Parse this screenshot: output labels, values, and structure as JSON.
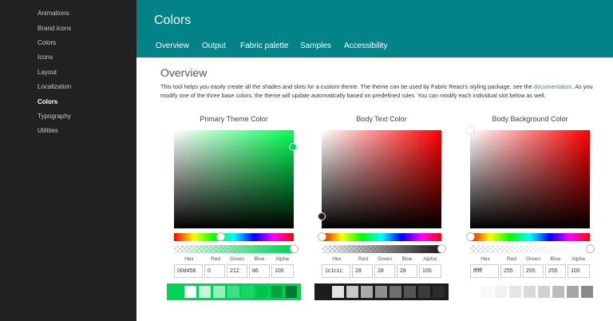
{
  "sidebar": {
    "items": [
      {
        "label": "Animations"
      },
      {
        "label": "Brand icons"
      },
      {
        "label": "Colors"
      },
      {
        "label": "Icons"
      },
      {
        "label": "Layout"
      },
      {
        "label": "Localization"
      },
      {
        "label": "Colors",
        "active": true
      },
      {
        "label": "Typography"
      },
      {
        "label": "Utilities"
      }
    ]
  },
  "header": {
    "title": "Colors",
    "tabs": [
      {
        "label": "Overview"
      },
      {
        "label": "Output"
      },
      {
        "label": "Fabric palette"
      },
      {
        "label": "Samples"
      },
      {
        "label": "Accessibility"
      }
    ]
  },
  "overview": {
    "title": "Overview",
    "description_before_link": "This tool helps you easily create all the shades and slots for a custom theme. The theme can be used by Fabric React's styling package, see the ",
    "link_text": "documentation",
    "description_after_link": ". As you modify one of the three base colors, the theme will update automatically based on predefined rules. You can modify each individual slot below as well."
  },
  "field_labels": {
    "hex": "Hex",
    "red": "Red",
    "green": "Green",
    "blue": "Blue",
    "alpha": "Alpha"
  },
  "pickers": [
    {
      "title": "Primary Theme Color",
      "hue_color": "#00ff55",
      "hue_fraction": 0.39,
      "alpha_fraction": 1.0,
      "hex": "00d456",
      "red": "0",
      "green": "212",
      "blue": "86",
      "alpha": "100",
      "swatch_bg": "#00d456",
      "swatches": [
        "#ffffff",
        "#c7f5da",
        "#99ecbb",
        "#44dd85",
        "#18d767",
        "#00c24f",
        "#00a443",
        "#007a32"
      ]
    },
    {
      "title": "Body Text Color",
      "hue_color": "#ff0000",
      "hue_fraction": 0.0,
      "alpha_fraction": 1.0,
      "hex": "1c1c1c",
      "red": "28",
      "green": "28",
      "blue": "28",
      "alpha": "100",
      "swatch_bg": "#1c1c1c",
      "swatches": [
        "#e3e3e3",
        "#c7c7c7",
        "#aaaaaa",
        "#8f8f8f",
        "#6f6f6f",
        "#555555",
        "#3c3c3c",
        "#2b2b2b"
      ]
    },
    {
      "title": "Body Background Color",
      "hue_color": "#ff0000",
      "hue_fraction": 0.0,
      "alpha_fraction": 1.0,
      "hex": "ffffff",
      "red": "255",
      "green": "255",
      "blue": "255",
      "alpha": "100",
      "swatch_bg": "#ffffff",
      "swatches": [
        "#f8f8f8",
        "#f0f0f0",
        "#e6e6e6",
        "#dadada",
        "#d0d0d0",
        "#bcbcbc",
        "#a5a5a5",
        "#8a8a8a"
      ]
    }
  ],
  "colors": {
    "header_bg": "#038387",
    "sidebar_bg": "#212121",
    "link": "#1aaa55"
  }
}
